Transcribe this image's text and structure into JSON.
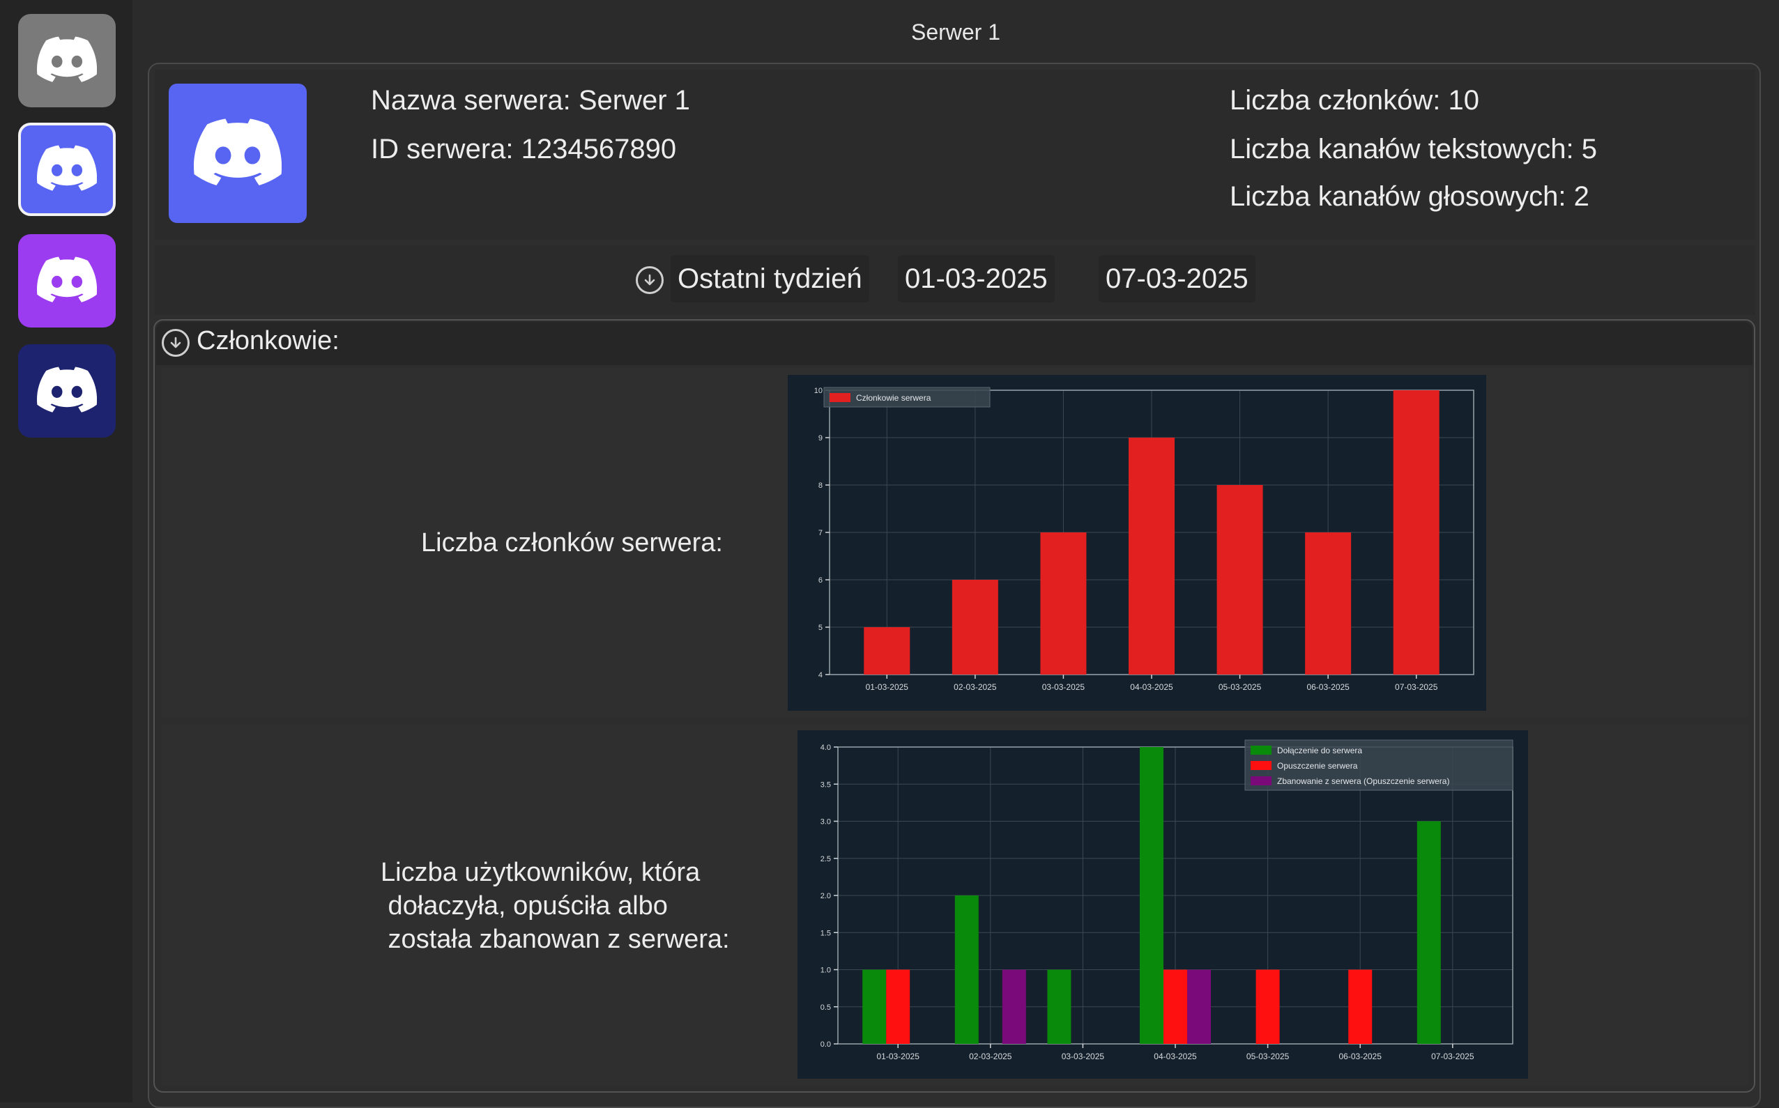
{
  "window": {
    "title": "Serwer 1"
  },
  "servers": [
    {
      "icon": "discord-icon",
      "color": "#7a7a7a",
      "selected": false
    },
    {
      "icon": "discord-icon",
      "color": "#5865f2",
      "selected": true
    },
    {
      "icon": "discord-icon",
      "color": "#9b3cf0",
      "selected": false
    },
    {
      "icon": "discord-icon",
      "color": "#1e2370",
      "selected": false
    }
  ],
  "server_info": {
    "name_line": "Nazwa serwera: Serwer 1",
    "id_line": "ID serwera: 1234567890",
    "members_line": "Liczba członków: 10",
    "text_channels_line": "Liczba kanałów tekstowych: 5",
    "voice_channels_line": "Liczba kanałów głosowych: 2",
    "icon_color": "#5865f2"
  },
  "date_range": {
    "preset": "Ostatni tydzień",
    "start": "01-03-2025",
    "end": "07-03-2025"
  },
  "members_section": {
    "title": "Członkowie:",
    "chart1_label": "Liczba członków serwera:",
    "chart2_label": "Liczba użytkowników, która\n dołaczyła, opuściła albo\n została zbanowan z serwera:"
  },
  "chart_data": [
    {
      "type": "bar",
      "categories": [
        "01-03-2025",
        "02-03-2025",
        "03-03-2025",
        "04-03-2025",
        "05-03-2025",
        "06-03-2025",
        "07-03-2025"
      ],
      "series": [
        {
          "name": "Członkowie serwera",
          "color": "#e32020",
          "values": [
            5,
            6,
            7,
            9,
            8,
            7,
            10
          ]
        }
      ],
      "ylim": [
        4,
        10
      ],
      "yticks": [
        4,
        5,
        6,
        7,
        8,
        9,
        10
      ],
      "grid": true,
      "legend": "top-left",
      "background": "#14202b"
    },
    {
      "type": "bar",
      "categories": [
        "01-03-2025",
        "02-03-2025",
        "03-03-2025",
        "04-03-2025",
        "05-03-2025",
        "06-03-2025",
        "07-03-2025"
      ],
      "series": [
        {
          "name": "Dołączenie do serwera",
          "color": "#0a8a0a",
          "values": [
            1,
            2,
            1,
            4,
            0,
            0,
            3
          ]
        },
        {
          "name": "Opuszczenie serwera",
          "color": "#ff1010",
          "values": [
            1,
            0,
            0,
            1,
            1,
            1,
            0
          ]
        },
        {
          "name": "Zbanowanie z serwera (Opuszczenie serwera)",
          "color": "#7a0a7a",
          "values": [
            0,
            1,
            0,
            1,
            0,
            0,
            0
          ]
        }
      ],
      "ylim": [
        0,
        4
      ],
      "yticks": [
        0.0,
        0.5,
        1.0,
        1.5,
        2.0,
        2.5,
        3.0,
        3.5,
        4.0
      ],
      "grid": true,
      "legend": "top-right",
      "background": "#14202b"
    }
  ]
}
